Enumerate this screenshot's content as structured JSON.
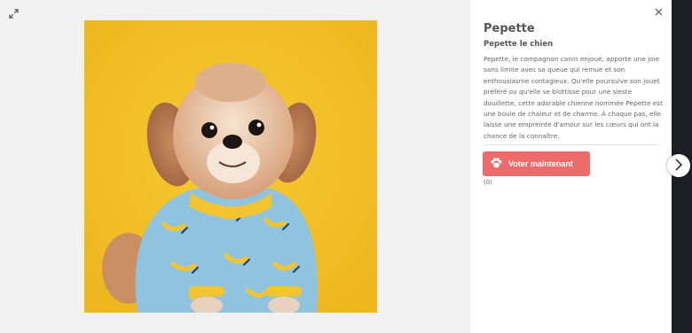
{
  "colors": {
    "stage_bg": "#f1f1f1",
    "panel_bg": "#ffffff",
    "vote_button": "#ec6c6c",
    "photo_bg": "#f3c42a"
  },
  "icons": {
    "expand": "expand-arrows-icon",
    "close": "close-icon",
    "paw": "paw-icon",
    "next": "chevron-right-icon"
  },
  "panel": {
    "title": "Pepette",
    "subtitle": "Pepette le chien",
    "description": "Pepette, le compagnon canin enjoué, apporte une joie sans limite avec sa queue qui remue et son enthousiasme contagieux. Qu'elle poursuive son jouet préféré ou qu'elle se blottisse pour une sieste douillette, cette adorable chienne nommée Pepette est une boule de chaleur et de charme. À chaque pas, elle laisse une empreinte d'amour sur les cœurs qui ont la chance de la connaître.",
    "vote_label": "Voter maintenant",
    "vote_count": "(0)"
  }
}
